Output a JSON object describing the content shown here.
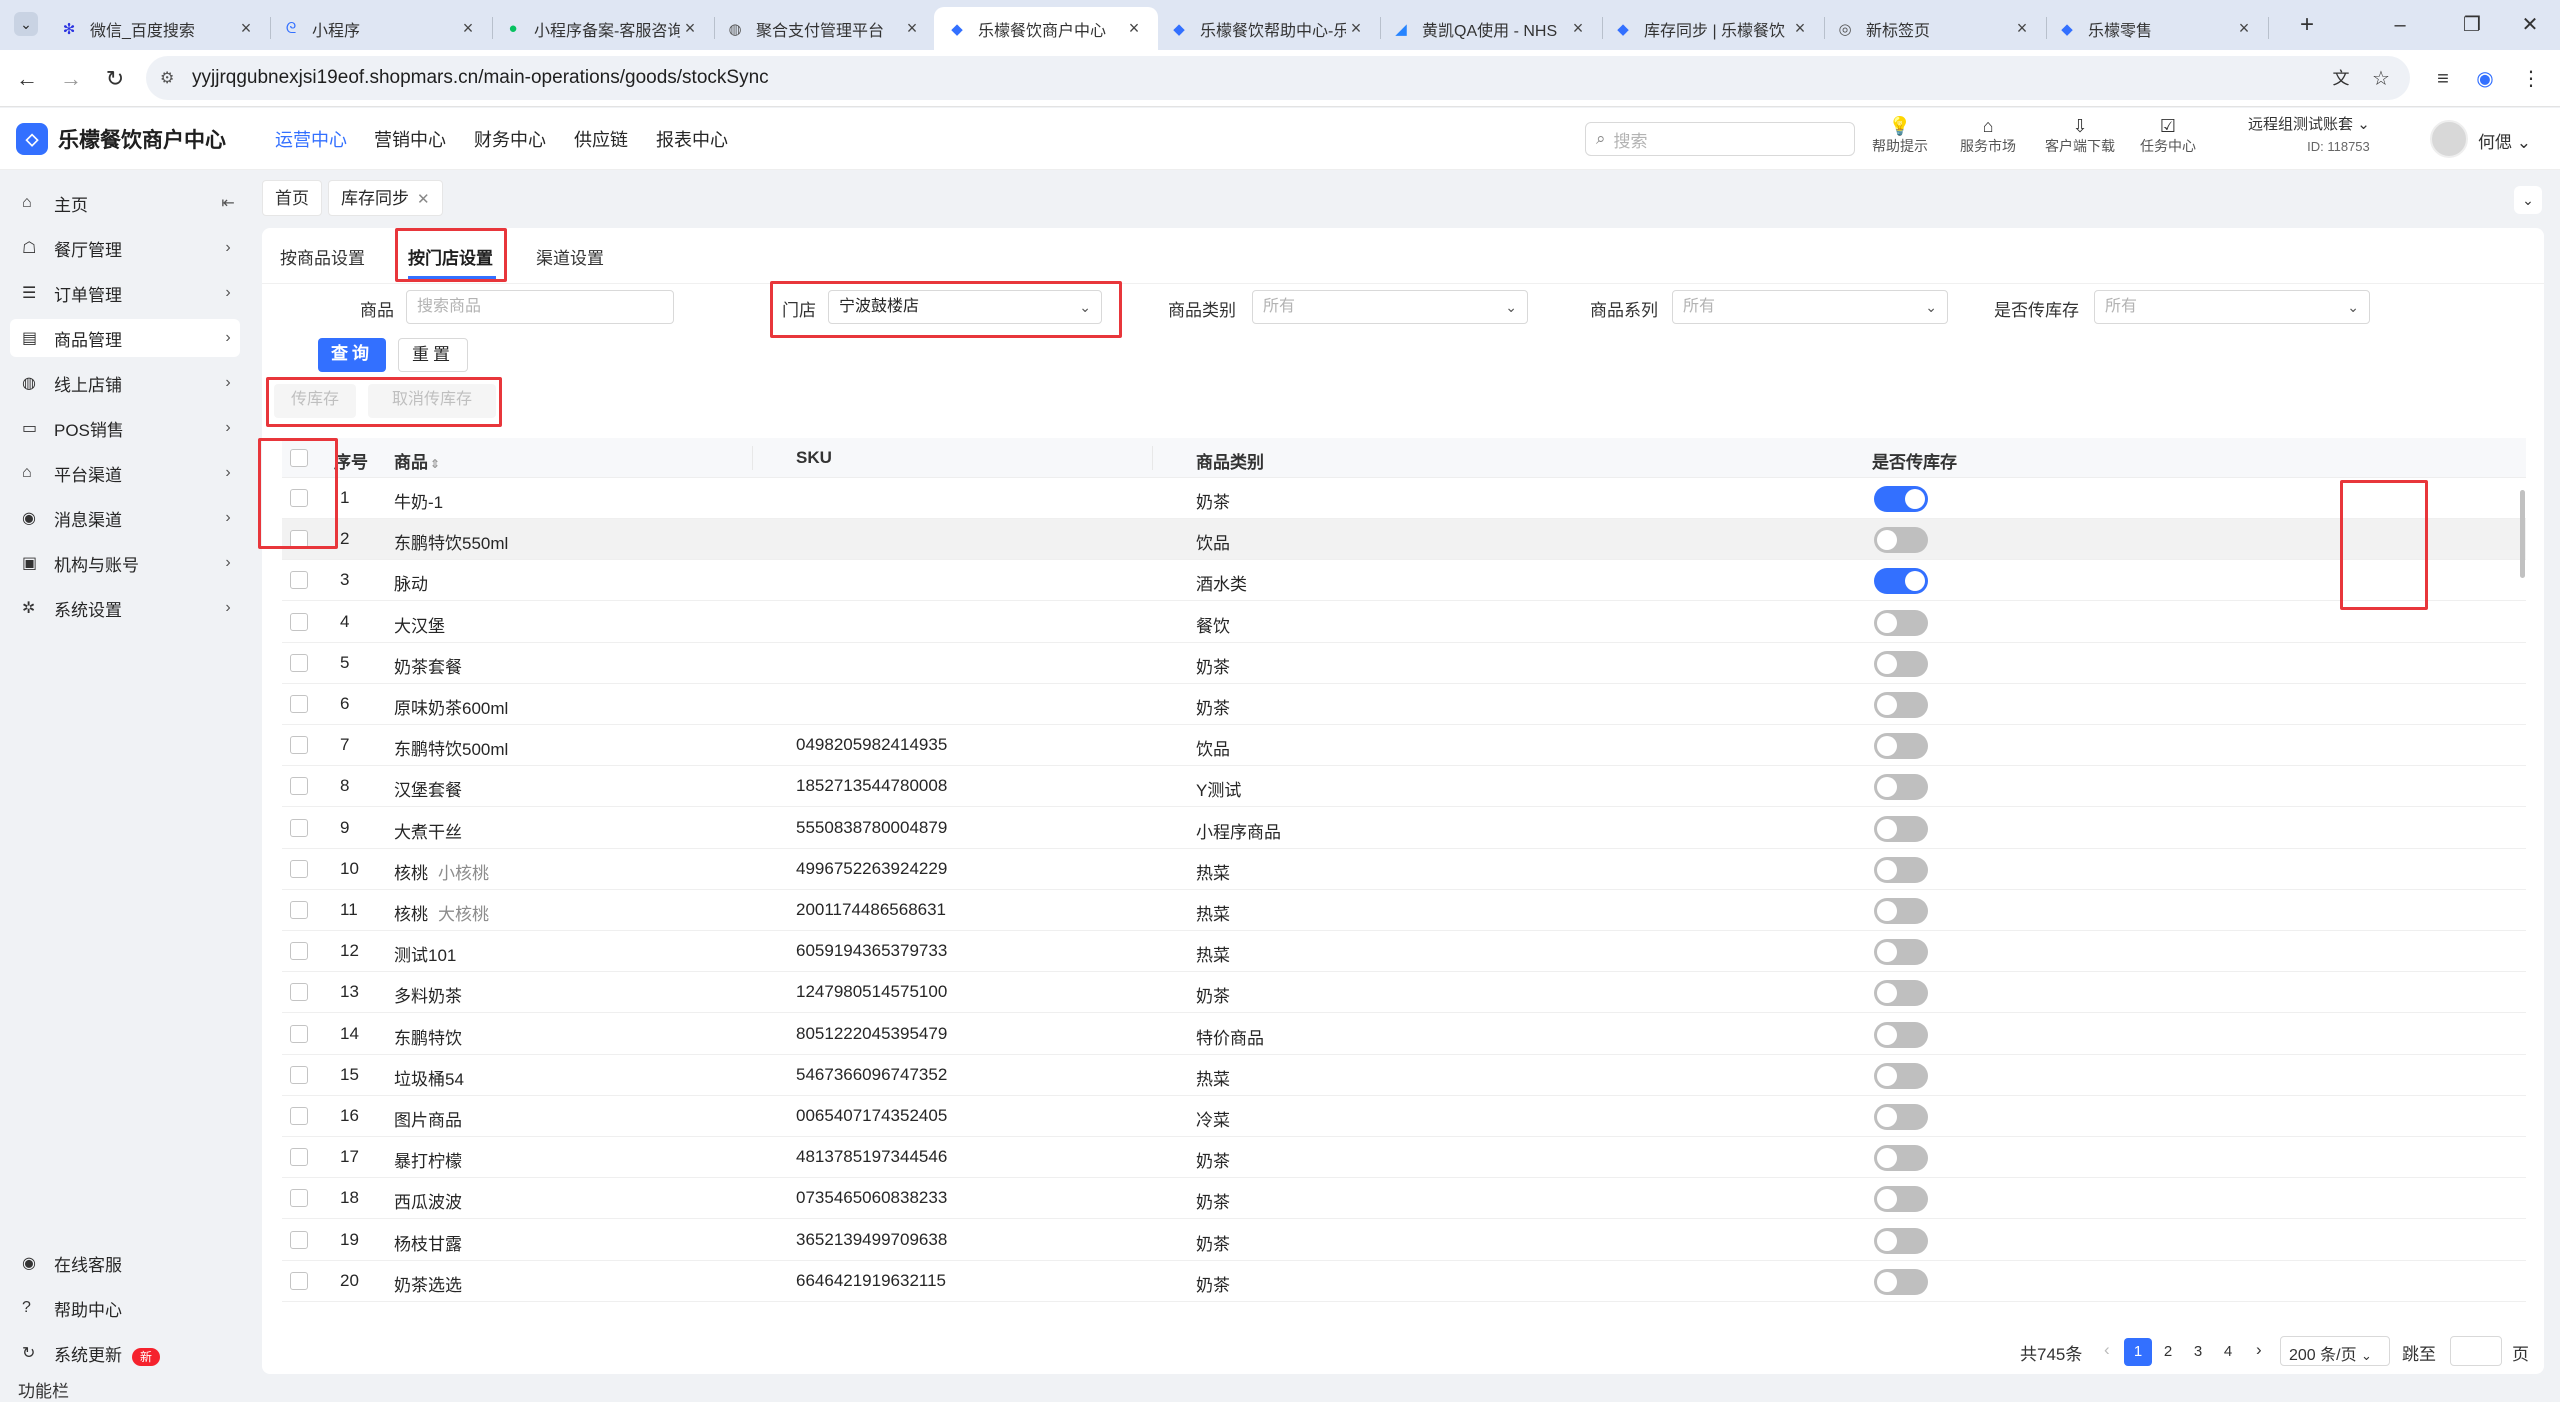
{
  "browser": {
    "tabs": [
      {
        "title": "微信_百度搜索",
        "icon": "baidu-icon",
        "color": "#2932e1"
      },
      {
        "title": "小程序",
        "icon": "miniprogram-icon",
        "color": "#3370ff"
      },
      {
        "title": "小程序备案-客服咨询",
        "icon": "wechat-icon",
        "color": "#07c160"
      },
      {
        "title": "聚合支付管理平台",
        "icon": "globe-icon",
        "color": "#555555"
      },
      {
        "title": "乐檬餐饮商户中心",
        "icon": "lemeng-icon",
        "color": "#3370ff",
        "active": true
      },
      {
        "title": "乐檬餐饮帮助中心-乐",
        "icon": "lemeng-icon",
        "color": "#3370ff"
      },
      {
        "title": "黄凯QA使用 - NHS",
        "icon": "jira-icon",
        "color": "#2684ff"
      },
      {
        "title": "库存同步 | 乐檬餐饮",
        "icon": "lemeng-icon",
        "color": "#3370ff"
      },
      {
        "title": "新标签页",
        "icon": "chrome-icon",
        "color": "#555555"
      },
      {
        "title": "乐檬零售",
        "icon": "lemeng-retail-icon",
        "color": "#3370ff"
      }
    ],
    "url": "yyjjrqgubnexjsi19eof.shopmars.cn/main-operations/goods/stockSync"
  },
  "header": {
    "brand": "乐檬餐饮商户中心",
    "nav": [
      "运营中心",
      "营销中心",
      "财务中心",
      "供应链",
      "报表中心"
    ],
    "search_placeholder": "搜索",
    "icons": [
      {
        "label": "帮助提示",
        "icon": "bulb-icon"
      },
      {
        "label": "服务市场",
        "icon": "shop-icon"
      },
      {
        "label": "客户端下载",
        "icon": "download-icon"
      },
      {
        "label": "任务中心",
        "icon": "task-icon"
      }
    ],
    "account_name": "远程组测试账套",
    "account_id": "ID: 118753",
    "user": "何偲"
  },
  "sidebar": {
    "items": [
      {
        "label": "主页",
        "icon": "home-icon"
      },
      {
        "label": "餐厅管理",
        "icon": "store-icon"
      },
      {
        "label": "订单管理",
        "icon": "order-icon"
      },
      {
        "label": "商品管理",
        "icon": "goods-icon"
      },
      {
        "label": "线上店铺",
        "icon": "online-shop-icon"
      },
      {
        "label": "POS销售",
        "icon": "pos-icon"
      },
      {
        "label": "平台渠道",
        "icon": "channel-icon"
      },
      {
        "label": "消息渠道",
        "icon": "message-icon"
      },
      {
        "label": "机构与账号",
        "icon": "org-icon"
      },
      {
        "label": "系统设置",
        "icon": "settings-icon"
      }
    ],
    "function_bar_label": "功能栏",
    "function_items": [
      {
        "label": "在线客服",
        "icon": "service-icon"
      },
      {
        "label": "帮助中心",
        "icon": "help-icon"
      },
      {
        "label": "系统更新",
        "icon": "update-icon",
        "badge": "新"
      }
    ]
  },
  "breadcrumbs": {
    "home": "首页",
    "current": "库存同步"
  },
  "subtabs": [
    "按商品设置",
    "按门店设置",
    "渠道设置"
  ],
  "filters": {
    "goods_label": "商品",
    "goods_placeholder": "搜索商品",
    "store_label": "门店",
    "store_value": "宁波鼓楼店",
    "category_label": "商品类别",
    "category_placeholder": "所有",
    "series_label": "商品系列",
    "series_placeholder": "所有",
    "sync_label": "是否传库存",
    "sync_placeholder": "所有",
    "query_btn": "查询",
    "reset_btn": "重置",
    "sync_btn": "传库存",
    "unsync_btn": "取消传库存"
  },
  "table": {
    "headers": {
      "index": "序号",
      "goods": "商品",
      "sku": "SKU",
      "category": "商品类别",
      "sync": "是否传库存"
    },
    "rows": [
      {
        "no": "1",
        "name": "牛奶-1",
        "sub": "",
        "sku": "",
        "cat": "奶茶",
        "on": true
      },
      {
        "no": "2",
        "name": "东鹏特饮550ml",
        "sub": "",
        "sku": "",
        "cat": "饮品",
        "on": false
      },
      {
        "no": "3",
        "name": "脉动",
        "sub": "",
        "sku": "",
        "cat": "酒水类",
        "on": true
      },
      {
        "no": "4",
        "name": "大汉堡",
        "sub": "",
        "sku": "",
        "cat": "餐饮",
        "on": false
      },
      {
        "no": "5",
        "name": "奶茶套餐",
        "sub": "",
        "sku": "",
        "cat": "奶茶",
        "on": false
      },
      {
        "no": "6",
        "name": "原味奶茶600ml",
        "sub": "",
        "sku": "",
        "cat": "奶茶",
        "on": false
      },
      {
        "no": "7",
        "name": "东鹏特饮500ml",
        "sub": "",
        "sku": "0498205982414935",
        "cat": "饮品",
        "on": false
      },
      {
        "no": "8",
        "name": "汉堡套餐",
        "sub": "",
        "sku": "1852713544780008",
        "cat": "Y测试",
        "on": false
      },
      {
        "no": "9",
        "name": "大煮干丝",
        "sub": "",
        "sku": "5550838780004879",
        "cat": "小程序商品",
        "on": false
      },
      {
        "no": "10",
        "name": "核桃",
        "sub": "小核桃",
        "sku": "4996752263924229",
        "cat": "热菜",
        "on": false
      },
      {
        "no": "11",
        "name": "核桃",
        "sub": "大核桃",
        "sku": "2001174486568631",
        "cat": "热菜",
        "on": false
      },
      {
        "no": "12",
        "name": "测试101",
        "sub": "",
        "sku": "6059194365379733",
        "cat": "热菜",
        "on": false
      },
      {
        "no": "13",
        "name": "多料奶茶",
        "sub": "",
        "sku": "1247980514575100",
        "cat": "奶茶",
        "on": false
      },
      {
        "no": "14",
        "name": "东鹏特饮",
        "sub": "",
        "sku": "8051222045395479",
        "cat": "特价商品",
        "on": false
      },
      {
        "no": "15",
        "name": "垃圾桶54",
        "sub": "",
        "sku": "5467366096747352",
        "cat": "热菜",
        "on": false
      },
      {
        "no": "16",
        "name": "图片商品",
        "sub": "",
        "sku": "0065407174352405",
        "cat": "冷菜",
        "on": false
      },
      {
        "no": "17",
        "name": "暴打柠檬",
        "sub": "",
        "sku": "4813785197344546",
        "cat": "奶茶",
        "on": false
      },
      {
        "no": "18",
        "name": "西瓜波波",
        "sub": "",
        "sku": "0735465060838233",
        "cat": "奶茶",
        "on": false
      },
      {
        "no": "19",
        "name": "杨枝甘露",
        "sub": "",
        "sku": "3652139499709638",
        "cat": "奶茶",
        "on": false
      },
      {
        "no": "20",
        "name": "奶茶选选",
        "sub": "",
        "sku": "6646421919632115",
        "cat": "奶茶",
        "on": false
      }
    ]
  },
  "pagination": {
    "total": "共745条",
    "pages": [
      "1",
      "2",
      "3",
      "4"
    ],
    "current": "1",
    "page_size": "200 条/页",
    "jump_label": "跳至",
    "page_suffix": "页"
  },
  "colors": {
    "accent": "#3370ff",
    "highlight_box": "#e8363b"
  }
}
